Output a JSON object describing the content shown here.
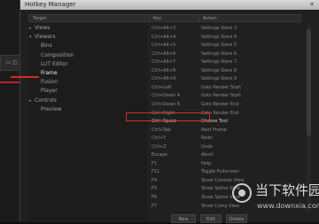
{
  "window": {
    "title": "Hotkey Manager",
    "close_glyph": "✕"
  },
  "columns": {
    "target": "Target",
    "key": "Key",
    "action": "Action"
  },
  "background": {
    "tab_label": "▭ ◫"
  },
  "tree": [
    {
      "label": "Views",
      "arrow": "▸",
      "indent": 0
    },
    {
      "label": "Viewers",
      "arrow": "▾",
      "indent": 0
    },
    {
      "label": "Bins",
      "arrow": "",
      "indent": 1
    },
    {
      "label": "Composition",
      "arrow": "",
      "indent": 1
    },
    {
      "label": "LUT Editor",
      "arrow": "",
      "indent": 1
    },
    {
      "label": "Frame",
      "arrow": "",
      "indent": 1,
      "selected": true
    },
    {
      "label": "Fusion",
      "arrow": "",
      "indent": 1
    },
    {
      "label": "Player",
      "arrow": "",
      "indent": 1
    },
    {
      "label": "Controls",
      "arrow": "▸",
      "indent": 0
    },
    {
      "label": "Preview",
      "arrow": "",
      "indent": 1
    }
  ],
  "bindings": [
    {
      "key": "Ctrl+Alt+3",
      "action": "Settings Store 3"
    },
    {
      "key": "Ctrl+Alt+4",
      "action": "Settings Store 4"
    },
    {
      "key": "Ctrl+Alt+5",
      "action": "Settings Store 5"
    },
    {
      "key": "Ctrl+Alt+6",
      "action": "Settings Store 6"
    },
    {
      "key": "Ctrl+Alt+7",
      "action": "Settings Store 7"
    },
    {
      "key": "Ctrl+Alt+8",
      "action": "Settings Store 8"
    },
    {
      "key": "Ctrl+Alt+9",
      "action": "Settings Store 9"
    },
    {
      "key": "Ctrl+Left",
      "action": "Goto Render Start"
    },
    {
      "key": "Ctrl+Down 4",
      "action": "Goto Render Start"
    },
    {
      "key": "Ctrl+Down 6",
      "action": "Goto Render End"
    },
    {
      "key": "Ctrl+Right",
      "action": "Goto Render End"
    },
    {
      "key": "Ctrl+Space",
      "action": "Choose Tool",
      "highlight": true
    },
    {
      "key": "Ctrl+Tab",
      "action": "Next Frame"
    },
    {
      "key": "Ctrl+Y",
      "action": "Redo"
    },
    {
      "key": "Ctrl+Z",
      "action": "Undo"
    },
    {
      "key": "Escape",
      "action": "Abort"
    },
    {
      "key": "F1",
      "action": "Help"
    },
    {
      "key": "F11",
      "action": "Toggle Fullscreen"
    },
    {
      "key": "F4",
      "action": "Show Console View"
    },
    {
      "key": "F5",
      "action": "Show Spline View"
    },
    {
      "key": "F6",
      "action": "Show Spline View"
    },
    {
      "key": "F7",
      "action": "Show Comp View"
    }
  ],
  "buttons": {
    "new": "New",
    "b2": "Edit",
    "b3": "Delete"
  },
  "watermark": {
    "text_cn": "当下软件园",
    "url": "www.downxia.com"
  }
}
